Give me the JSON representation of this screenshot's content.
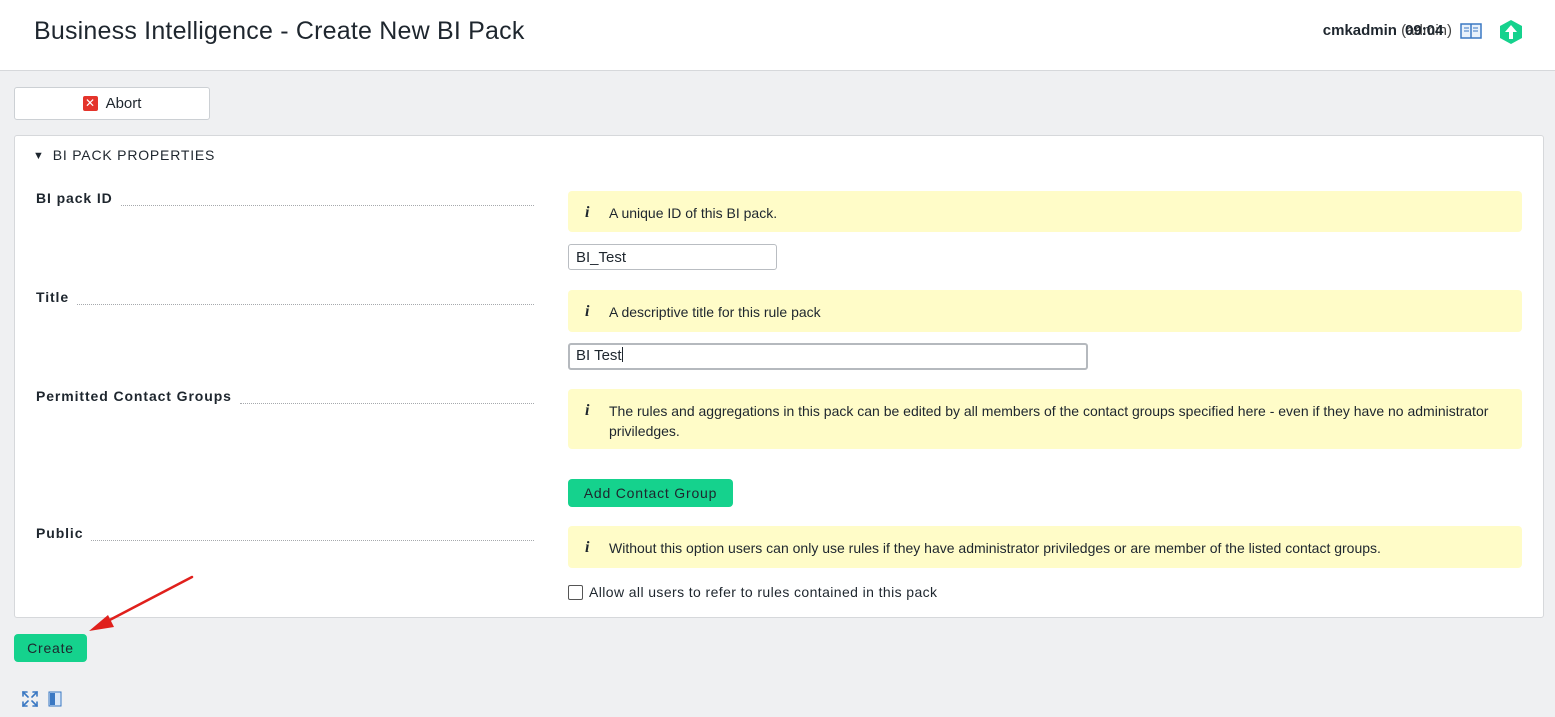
{
  "header": {
    "title": "Business Intelligence - Create New BI Pack",
    "username": "cmkadmin",
    "role": "(admin)",
    "time": "09:04",
    "icons": [
      "book-icon",
      "checkmk-logo-icon"
    ]
  },
  "toolbar": {
    "abort_label": "Abort",
    "abort_icon": "close-icon"
  },
  "section": {
    "title": "BI PACK PROPERTIES",
    "expanded": true
  },
  "fields": {
    "pack_id": {
      "label": "BI pack ID",
      "help": "A unique ID of this BI pack.",
      "value": "BI_Test"
    },
    "title": {
      "label": "Title",
      "help": "A descriptive title for this rule pack",
      "value": "BI Test"
    },
    "contact_groups": {
      "label": "Permitted Contact Groups",
      "help": "The rules and aggregations in this pack can be edited by all members of the contact groups specified here - even if they have no administrator priviledges.",
      "add_label": "Add Contact Group"
    },
    "public": {
      "label": "Public",
      "help": "Without this option users can only use rules if they have administrator priviledges or are member of the listed contact groups.",
      "checkbox_label": "Allow all users to refer to rules contained in this pack",
      "checked": false
    }
  },
  "actions": {
    "create_label": "Create"
  },
  "footer_icons": [
    "fullscreen-icon",
    "manual-icon"
  ],
  "colors": {
    "accent": "#15d28d",
    "help_background": "#fffcc8",
    "abort_red": "#e4342b",
    "annotation_arrow": "#e0201c"
  }
}
